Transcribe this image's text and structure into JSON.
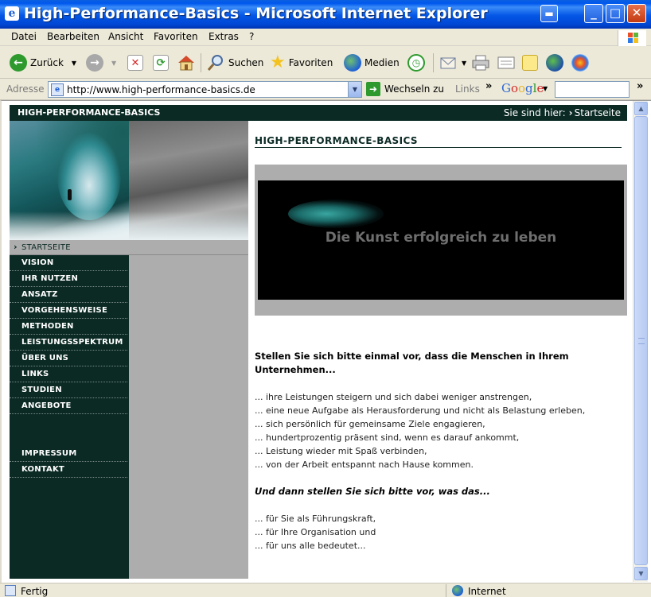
{
  "window": {
    "title": "High-Performance-Basics - Microsoft Internet Explorer"
  },
  "menu": [
    "Datei",
    "Bearbeiten",
    "Ansicht",
    "Favoriten",
    "Extras",
    "?"
  ],
  "toolbar": {
    "back": "Zurück",
    "search": "Suchen",
    "favorites": "Favoriten",
    "media": "Medien"
  },
  "address": {
    "label": "Adresse",
    "url": "http://www.high-performance-basics.de",
    "go": "Wechseln zu",
    "links": "Links"
  },
  "google": {
    "logo": "Google"
  },
  "page": {
    "brand": "HIGH-PERFORMANCE-BASICS",
    "breadcrumb_prefix": "Sie sind hier:",
    "breadcrumb_current": "Startseite",
    "nav_current": "STARTSEITE",
    "nav": [
      "VISION",
      "IHR NUTZEN",
      "ANSATZ",
      "VORGEHENSWEISE",
      "METHODEN",
      "LEISTUNGSSPEKTRUM",
      "ÜBER UNS",
      "LINKS",
      "STUDIEN",
      "ANGEBOTE"
    ],
    "nav_bottom": [
      "IMPRESSUM",
      "KONTAKT"
    ],
    "heading": "HIGH-PERFORMANCE-BASICS",
    "banner_text": "Die Kunst erfolgreich zu leben",
    "intro_bold": "Stellen Sie sich bitte einmal vor, dass die Menschen in Ihrem Unternehmen...",
    "list1": [
      "... ihre Leistungen steigern und sich dabei weniger anstrengen,",
      "... eine neue Aufgabe als Herausforderung und nicht als Belastung erleben,",
      "... sich persönlich für gemeinsame Ziele engagieren,",
      "... hundertprozentig präsent sind, wenn es darauf ankommt,",
      "... Leistung wieder mit Spaß verbinden,",
      "... von der Arbeit entspannt nach Hause kommen."
    ],
    "italic_bold": "Und dann stellen Sie sich bitte vor, was das...",
    "list2": [
      "... für Sie als Führungskraft,",
      "... für Ihre Organisation und",
      "... für uns alle bedeutet..."
    ]
  },
  "status": {
    "text": "Fertig",
    "zone": "Internet"
  }
}
